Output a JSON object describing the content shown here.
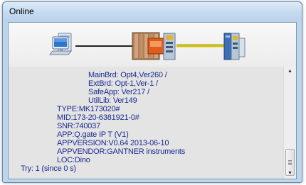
{
  "window": {
    "title": "Online"
  },
  "diagram": {
    "icons": [
      "computer-icon",
      "controller-module-icon",
      "io-terminal-icon"
    ],
    "colors": {
      "link_pc": "#222222",
      "link_modules": "#d8c400"
    }
  },
  "log": {
    "lines": [
      "MainBrd: Opt4,Ver260 /",
      "ExtBrd: Opt-1,Ver-1 /",
      "SafeApp: Ver217 /",
      "UtilLib: Ver149",
      "TYPE:MK173020#",
      "MID:173-20-6381921-0#",
      "SNR:740037",
      "APP:Q.gate IP T (V1)",
      "APPVERSION:V0.64 2013-06-10",
      "APPVENDOR:GANTNER instruments",
      "LOC:Dino",
      "Try: 1 (since 0 s)"
    ],
    "text_color": "#1a2a8f"
  },
  "scrollbar": {
    "up_icon": "up-arrow-icon",
    "down_icon": "down-arrow-icon"
  }
}
